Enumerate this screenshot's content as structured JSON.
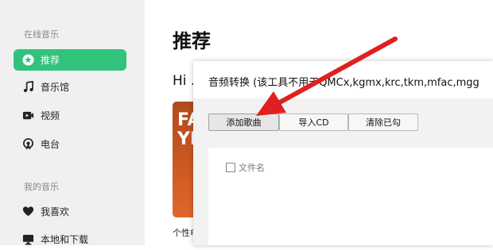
{
  "sidebar": {
    "online_section": "在线音乐",
    "mine_section": "我的音乐",
    "items": [
      {
        "label": "推荐",
        "icon": "star-icon",
        "active": true
      },
      {
        "label": "音乐馆",
        "icon": "music-note-icon"
      },
      {
        "label": "视频",
        "icon": "video-icon"
      },
      {
        "label": "电台",
        "icon": "radio-icon"
      },
      {
        "label": "我喜欢",
        "icon": "heart-icon"
      },
      {
        "label": "本地和下载",
        "icon": "monitor-icon"
      }
    ]
  },
  "main": {
    "title": "推荐",
    "greeting": "Hi ...",
    "card_text": "FA\nYI",
    "card_caption": "个性电"
  },
  "dialog": {
    "title": "音频转换 (该工具不用于QMCx,kgmx,krc,tkm,mfac,mgg",
    "buttons": {
      "add_songs": "添加歌曲",
      "import_cd": "导入CD",
      "clear_checked": "清除已勾"
    },
    "list_header": "文件名"
  },
  "colors": {
    "accent": "#31c27c",
    "annotation_arrow": "#e02020"
  }
}
